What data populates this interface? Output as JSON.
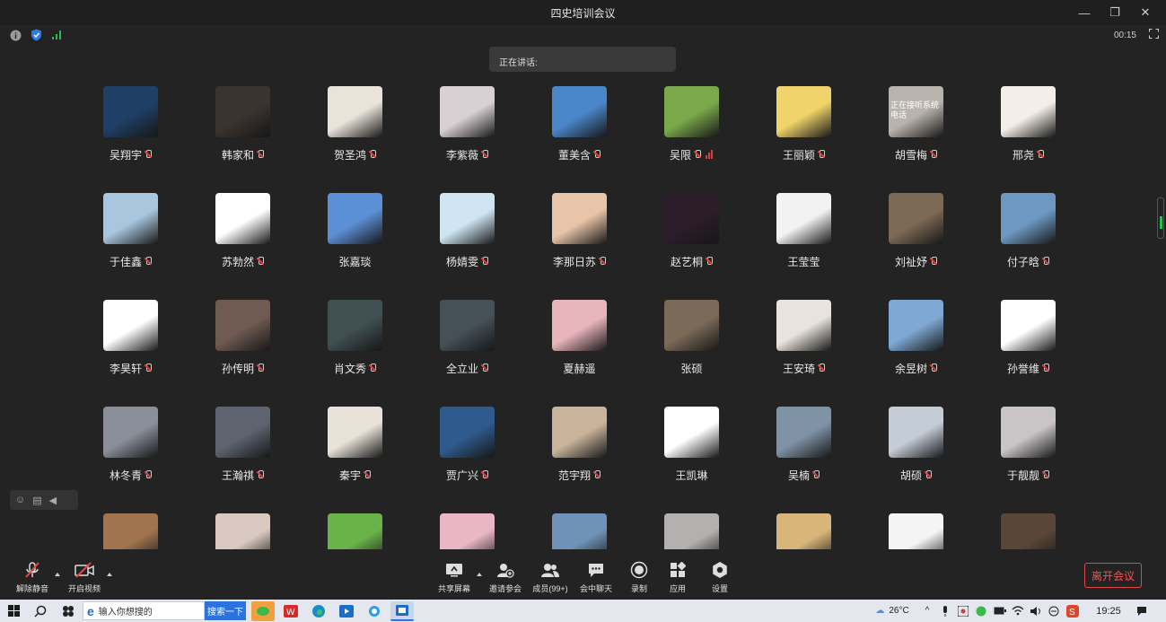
{
  "window": {
    "title": "四史培训会议"
  },
  "infobar": {
    "timer": "00:15"
  },
  "speaking": {
    "label": "正在讲话:"
  },
  "participants": [
    {
      "name": "吴翔宇",
      "muted": true,
      "bg": "#1f3f66"
    },
    {
      "name": "韩家和",
      "muted": true,
      "bg": "#3a3430"
    },
    {
      "name": "贺圣鸿",
      "muted": true,
      "bg": "#e9e3da"
    },
    {
      "name": "李紫薇",
      "muted": true,
      "bg": "#d8d0d2"
    },
    {
      "name": "董美含",
      "muted": true,
      "bg": "#4a86c9"
    },
    {
      "name": "吴限",
      "muted": true,
      "bg": "#7aa84a",
      "signal": true
    },
    {
      "name": "王丽颖",
      "muted": true,
      "bg": "#f0d36a"
    },
    {
      "name": "胡雪梅",
      "muted": true,
      "bg": "#b9b3ad",
      "overlay": "正在接听系统电话"
    },
    {
      "name": "邢尧",
      "muted": true,
      "bg": "#f4eee8"
    },
    {
      "name": "于佳鑫",
      "muted": true,
      "bg": "#a8c6de"
    },
    {
      "name": "苏勃然",
      "muted": true,
      "bg": "#ffffff"
    },
    {
      "name": "张嘉琰",
      "muted": false,
      "bg": "#5b8fd6"
    },
    {
      "name": "杨婧雯",
      "muted": true,
      "bg": "#cfe6f2"
    },
    {
      "name": "李那日苏",
      "muted": true,
      "bg": "#e8c4a8"
    },
    {
      "name": "赵艺桐",
      "muted": true,
      "bg": "#2c1d2a"
    },
    {
      "name": "王莹莹",
      "muted": false,
      "bg": "#f2f2f2"
    },
    {
      "name": "刘祉妤",
      "muted": true,
      "bg": "#7d6a56"
    },
    {
      "name": "付子晗",
      "muted": true,
      "bg": "#6d98c2"
    },
    {
      "name": "李昊轩",
      "muted": true,
      "bg": "#ffffff"
    },
    {
      "name": "孙传明",
      "muted": true,
      "bg": "#6f5b52"
    },
    {
      "name": "肖文秀",
      "muted": true,
      "bg": "#404f52"
    },
    {
      "name": "全立业",
      "muted": true,
      "bg": "#465057"
    },
    {
      "name": "夏赫遥",
      "muted": false,
      "bg": "#e9b5bd"
    },
    {
      "name": "张硕",
      "muted": false,
      "bg": "#7b6a58"
    },
    {
      "name": "王安琦",
      "muted": true,
      "bg": "#e8e3dc"
    },
    {
      "name": "余昱树",
      "muted": true,
      "bg": "#7fa8d4"
    },
    {
      "name": "孙誉维",
      "muted": true,
      "bg": "#ffffff"
    },
    {
      "name": "林冬青",
      "muted": true,
      "bg": "#8a8f9a"
    },
    {
      "name": "王瀚祺",
      "muted": true,
      "bg": "#5d6470"
    },
    {
      "name": "秦宇",
      "muted": true,
      "bg": "#e9e2d8"
    },
    {
      "name": "贾广兴",
      "muted": true,
      "bg": "#2f5a8e"
    },
    {
      "name": "范宇翔",
      "muted": true,
      "bg": "#c9b49b"
    },
    {
      "name": "王凯琳",
      "muted": false,
      "bg": "#ffffff"
    },
    {
      "name": "吴楠",
      "muted": true,
      "bg": "#7f93a6"
    },
    {
      "name": "胡硕",
      "muted": true,
      "bg": "#c4ccd6"
    },
    {
      "name": "于靓靓",
      "muted": true,
      "bg": "#c9c5c7"
    },
    {
      "name": "",
      "muted": false,
      "bg": "#a0744e"
    },
    {
      "name": "",
      "muted": false,
      "bg": "#d9c9c0"
    },
    {
      "name": "",
      "muted": false,
      "bg": "#6ab34a"
    },
    {
      "name": "",
      "muted": false,
      "bg": "#e8b6c5"
    },
    {
      "name": "",
      "muted": false,
      "bg": "#6f93b8"
    },
    {
      "name": "",
      "muted": false,
      "bg": "#b5b0b0"
    },
    {
      "name": "",
      "muted": false,
      "bg": "#d8b57a"
    },
    {
      "name": "",
      "muted": false,
      "bg": "#f4f4f4"
    },
    {
      "name": "",
      "muted": false,
      "bg": "#5a4638"
    }
  ],
  "toolbar": {
    "unmute": "解除静音",
    "start_video": "开启视频",
    "share": "共享屏幕",
    "invite": "邀请参会",
    "members": "成员(99+)",
    "chat": "会中聊天",
    "record": "录制",
    "apps": "应用",
    "settings": "设置",
    "leave": "离开会议"
  },
  "taskbar": {
    "search_placeholder": "输入你想搜的",
    "search_button": "搜索一下",
    "temperature": "26°C",
    "time": "19:25"
  },
  "colors": {
    "accent_red": "#e04848",
    "bg": "#232323"
  }
}
